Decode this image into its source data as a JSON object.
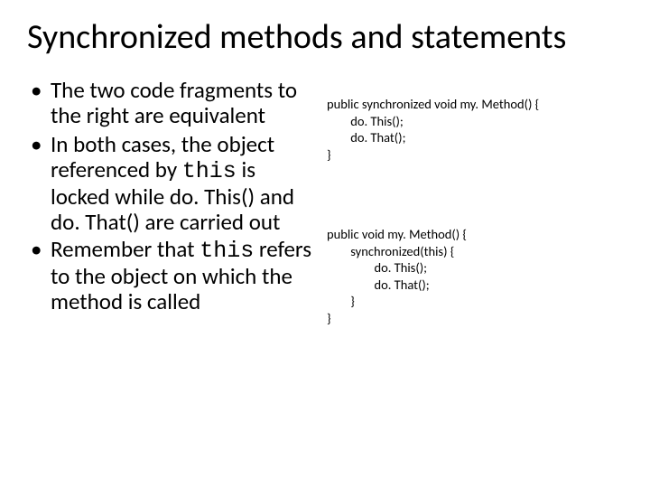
{
  "title": "Synchronized methods and statements",
  "bullets": [
    {
      "pre": "The two code fragments to the right are equivalent",
      "mono": "",
      "post": ""
    },
    {
      "pre": "In both cases, the object referenced by ",
      "mono": "this",
      "post": " is locked while do. This() and do. That() are carried out"
    },
    {
      "pre": "Remember that ",
      "mono": "this",
      "post": " refers to the object on which the method is called"
    }
  ],
  "code1": "public synchronized void my. Method() {\n        do. This();\n        do. That();\n}",
  "code2": "public void my. Method() {\n        synchronized(this) {\n                do. This();\n                do. That();\n        }\n}"
}
